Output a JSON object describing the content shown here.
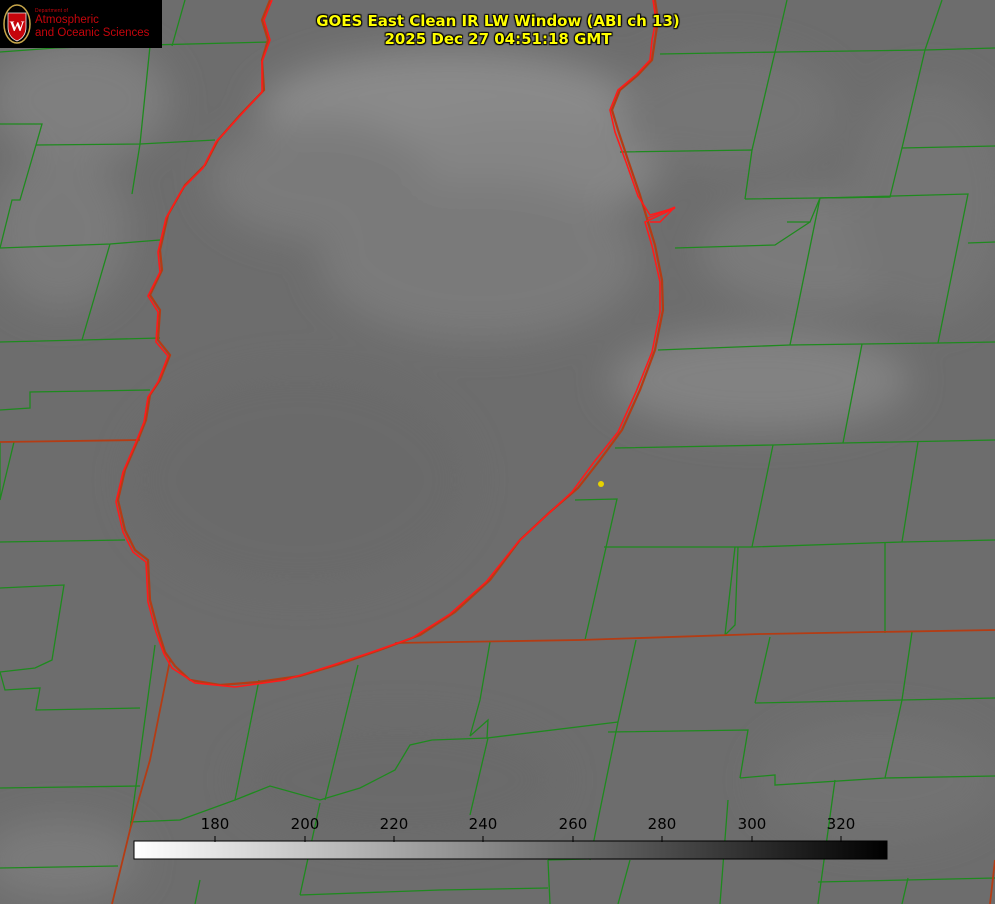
{
  "logo": {
    "dept_line": "Department of",
    "line1": "Atmospheric",
    "line2": "and Oceanic Sciences",
    "seal_letter": "W",
    "seal_color": "#c5050c"
  },
  "title": {
    "line1": "GOES East Clean IR LW Window (ABI ch 13)",
    "line2": "2025 Dec 27 04:51:18 GMT"
  },
  "colorbar": {
    "ticks": [
      "180",
      "200",
      "220",
      "240",
      "260",
      "280",
      "300",
      "320"
    ],
    "gradient_from": "#ffffff",
    "gradient_to": "#000000"
  },
  "map": {
    "background_color": "#6e6e6e",
    "county_line_color": "#1e8a1e",
    "state_line_color": "#b43c14",
    "lake_shore_color": "#ff1a1a",
    "station_marker_color": "#e6d200"
  }
}
